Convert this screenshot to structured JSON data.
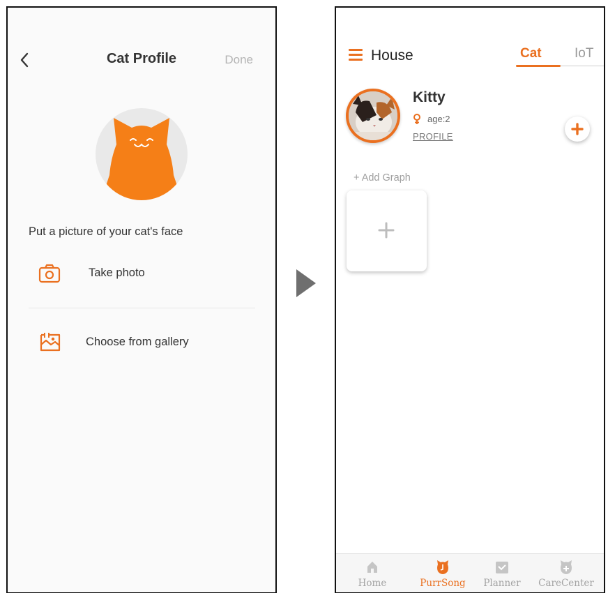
{
  "cat_profile_screen": {
    "title": "Cat Profile",
    "done_label": "Done",
    "prompt": "Put a picture of your cat's face",
    "take_photo_label": "Take photo",
    "gallery_label": "Choose from gallery"
  },
  "house_screen": {
    "title": "House",
    "tabs": [
      {
        "label": "Cat",
        "active": true
      },
      {
        "label": "IoT",
        "active": false
      }
    ],
    "pet": {
      "name": "Kitty",
      "age": "age:2",
      "profile_link": "PROFILE"
    },
    "add_graph_label": "+ Add Graph",
    "bottom_nav": [
      {
        "label": "Home",
        "icon": "home-icon",
        "active": false
      },
      {
        "label": "PurrSong",
        "icon": "purrsong-icon",
        "active": true
      },
      {
        "label": "Planner",
        "icon": "planner-icon",
        "active": false
      },
      {
        "label": "CareCenter",
        "icon": "carecenter-icon",
        "active": false
      }
    ]
  },
  "colors": {
    "accent": "#EA7020",
    "inactive": "#A3A3A3"
  }
}
